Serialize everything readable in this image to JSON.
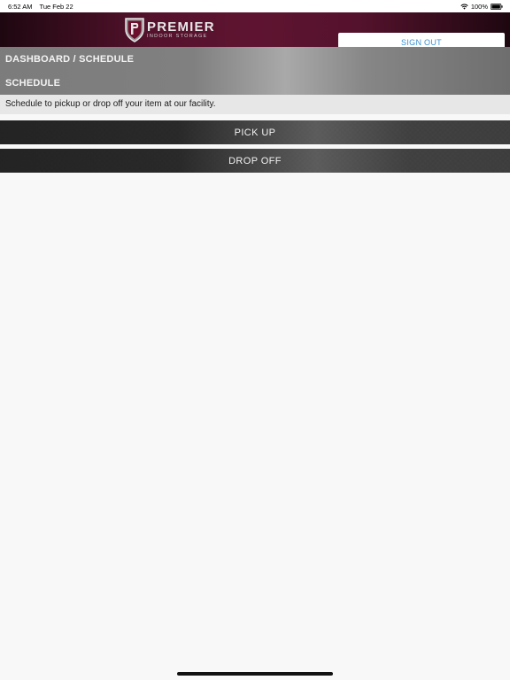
{
  "status_bar": {
    "time": "6:52 AM",
    "date": "Tue Feb 22",
    "battery": "100%",
    "icons": [
      "wifi-icon",
      "battery-icon"
    ]
  },
  "header": {
    "logo_word": "PREMIER",
    "logo_sub": "INDOOR STORAGE",
    "sign_out_label": "SIGN OUT",
    "colors": {
      "header_dark": "#1e0710",
      "header_mid": "#5e1430",
      "sign_out_text": "#3a8fd0"
    }
  },
  "page": {
    "breadcrumb": "DASHBOARD / SCHEDULE",
    "title": "SCHEDULE",
    "description": "Schedule to pickup or drop off your item at our facility."
  },
  "actions": {
    "pickup_label": "PICK UP",
    "dropoff_label": "DROP OFF"
  }
}
